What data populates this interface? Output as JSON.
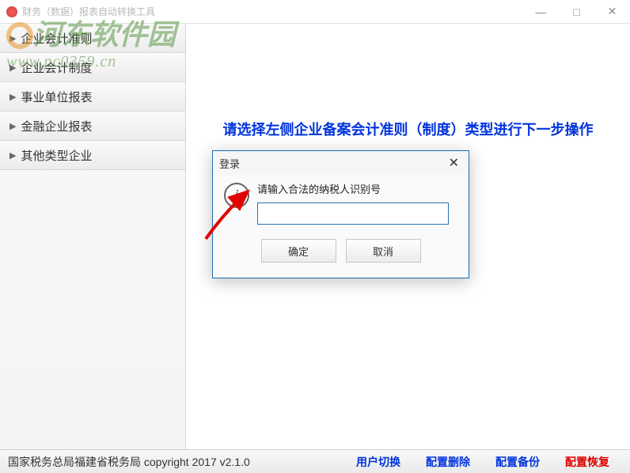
{
  "window": {
    "title": "财务（数据）报表自动转换工具",
    "minimize": "—",
    "maximize": "□",
    "close": "✕"
  },
  "sidebar": {
    "items": [
      {
        "label": "企业会计准则"
      },
      {
        "label": "企业会计制度"
      },
      {
        "label": "事业单位报表"
      },
      {
        "label": "金融企业报表"
      },
      {
        "label": "其他类型企业"
      }
    ]
  },
  "main": {
    "hint": "请选择左侧企业备案会计准则（制度）类型进行下一步操作"
  },
  "dialog": {
    "title": "登录",
    "message": "请输入合法的纳税人识别号",
    "input_value": "",
    "ok": "确定",
    "cancel": "取消"
  },
  "statusbar": {
    "copyright": "国家税务总局福建省税务局  copyright 2017  v2.1.0",
    "links": {
      "switch_user": "用户切换",
      "config_delete": "配置删除",
      "config_backup": "配置备份",
      "config_restore": "配置恢复"
    }
  },
  "watermark": {
    "name": "河东软件园",
    "url": "www.pc0359.cn"
  }
}
